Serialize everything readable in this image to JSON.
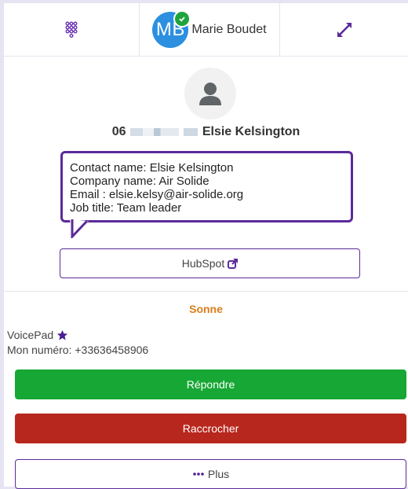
{
  "header": {
    "user_initials": "MB",
    "user_name": "Marie Boudet",
    "status": "online"
  },
  "contact": {
    "number_prefix": "06",
    "name": "Elsie Kelsington"
  },
  "details": {
    "contact_name": "Contact name: Elsie Kelsington",
    "company_name": "Company name: Air Solide",
    "email": "Email : elsie.kelsy@air-solide.org",
    "job_title": "Job title: Team leader"
  },
  "crm": {
    "label": "HubSpot"
  },
  "call": {
    "status": "Sonne",
    "line_name": "VoicePad",
    "my_number": "Mon numéro: +33636458906"
  },
  "actions": {
    "answer": "Répondre",
    "hangup": "Raccrocher",
    "more": "Plus"
  },
  "colors": {
    "accent": "#5b2a9a",
    "answer": "#16a734",
    "hangup": "#b8271e",
    "ringing": "#d97d1b",
    "avatar": "#2c8fe0"
  }
}
